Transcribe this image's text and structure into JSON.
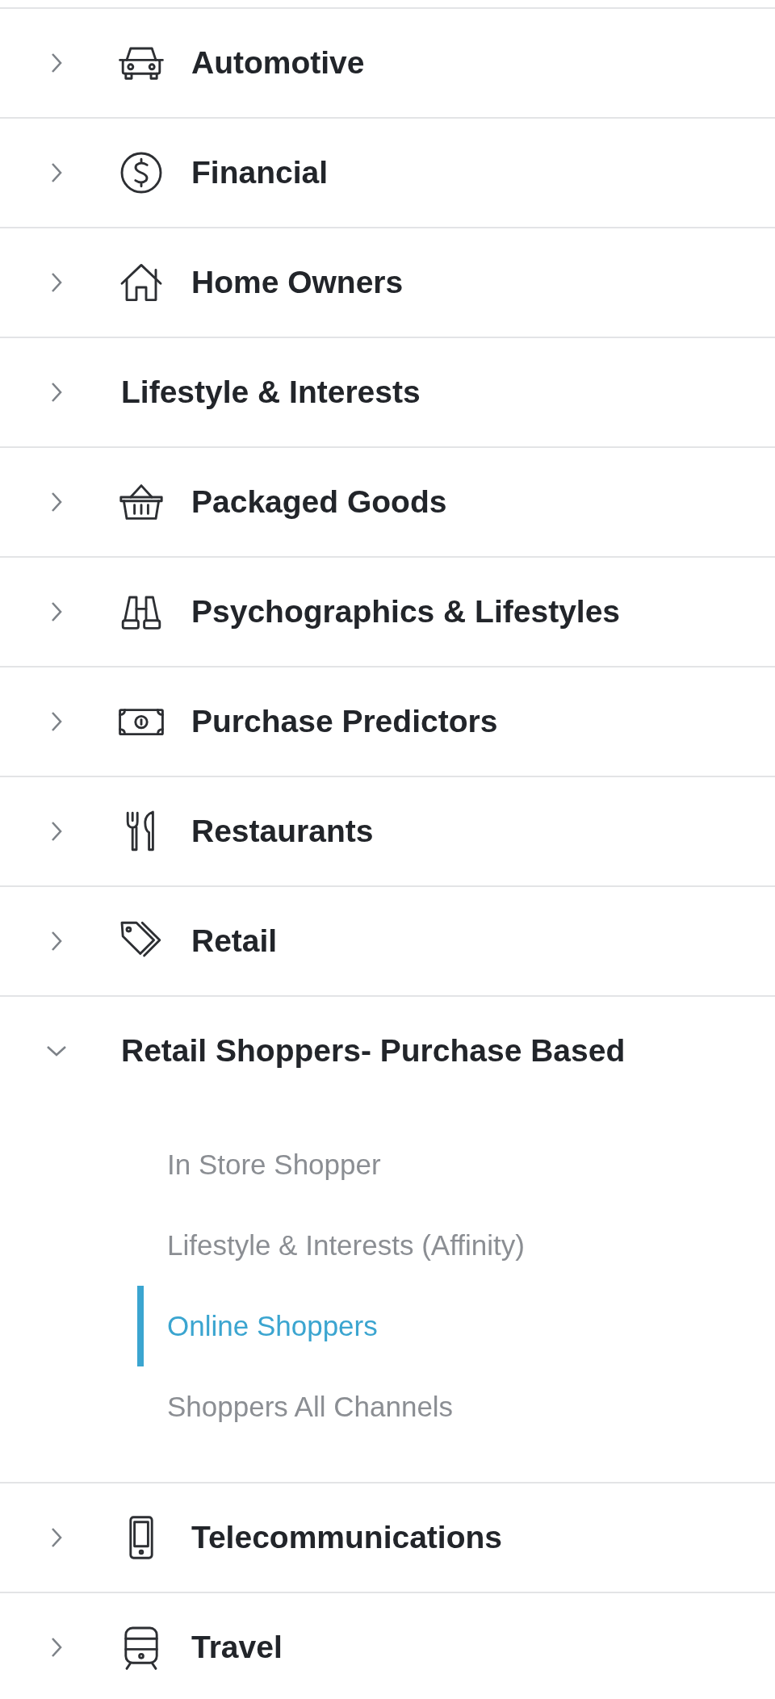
{
  "categories": [
    {
      "label": "Automotive",
      "expanded": false
    },
    {
      "label": "Financial",
      "expanded": false
    },
    {
      "label": "Home Owners",
      "expanded": false
    },
    {
      "label": "Lifestyle & Interests",
      "expanded": false
    },
    {
      "label": "Packaged Goods",
      "expanded": false
    },
    {
      "label": "Psychographics & Lifestyles",
      "expanded": false
    },
    {
      "label": "Purchase Predictors",
      "expanded": false
    },
    {
      "label": "Restaurants",
      "expanded": false
    },
    {
      "label": "Retail",
      "expanded": false
    },
    {
      "label": "Retail Shoppers- Purchase Based",
      "expanded": true,
      "children": [
        {
          "label": "In Store Shopper",
          "selected": false
        },
        {
          "label": "Lifestyle & Interests (Affinity)",
          "selected": false
        },
        {
          "label": "Online Shoppers",
          "selected": true
        },
        {
          "label": "Shoppers All Channels",
          "selected": false
        }
      ]
    },
    {
      "label": "Telecommunications",
      "expanded": false
    },
    {
      "label": "Travel",
      "expanded": false
    }
  ]
}
